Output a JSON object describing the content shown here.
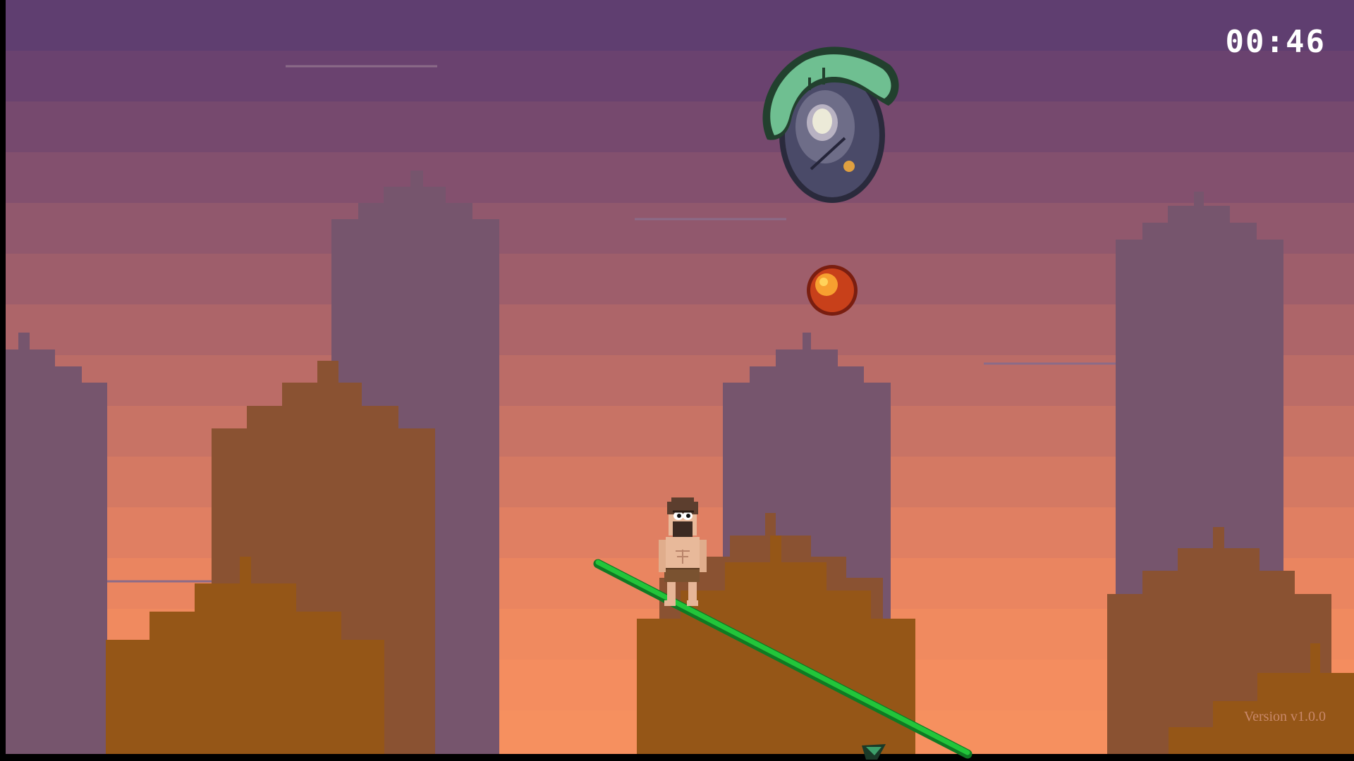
{
  "hud": {
    "timer": "00:46",
    "version": "Version v1.0.0"
  },
  "colors": {
    "sky_top": "#5f3e70",
    "sky_bottom": "#f48d5f",
    "far_buildings": "#76556d",
    "mid_buildings": "#8a5232",
    "near_buildings": "#955617",
    "rope": "#22c53a",
    "fireball": "#c8401a",
    "boss_shell": "#4a4a68",
    "boss_slime": "#6fbf91"
  },
  "entities": {
    "player": "caveman-player",
    "enemy": "slime-egg-boss",
    "projectile": "fireball",
    "rope": "green-vine-rope",
    "anchor": "rope-anchor-icon"
  }
}
